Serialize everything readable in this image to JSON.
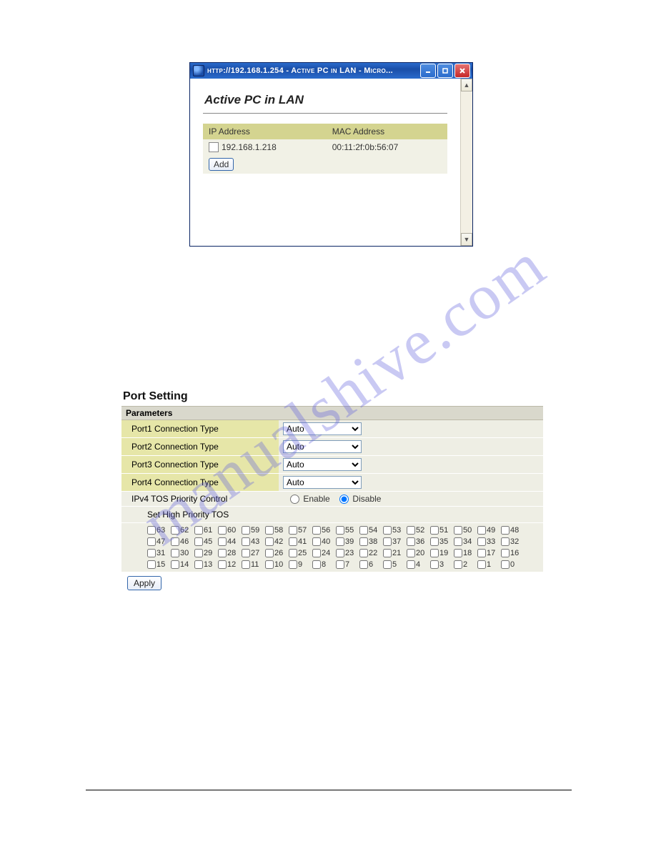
{
  "watermark": "manualshive.com",
  "ie_window": {
    "title": "http://192.168.1.254 - Active PC in LAN - Micro...",
    "heading": "Active PC in LAN",
    "columns": {
      "ip": "IP Address",
      "mac": "MAC Address"
    },
    "rows": [
      {
        "ip": "192.168.1.218",
        "mac": "00:11:2f:0b:56:07"
      }
    ],
    "add_label": "Add"
  },
  "port_setting": {
    "title": "Port Setting",
    "parameters_label": "Parameters",
    "rows": [
      {
        "label": "Port1 Connection Type",
        "value": "Auto"
      },
      {
        "label": "Port2 Connection Type",
        "value": "Auto"
      },
      {
        "label": "Port3 Connection Type",
        "value": "Auto"
      },
      {
        "label": "Port4 Connection Type",
        "value": "Auto"
      }
    ],
    "tos_control": {
      "label": "IPv4 TOS Priority Control",
      "enable": "Enable",
      "disable": "Disable",
      "selected": "disable"
    },
    "tos_heading": "Set High Priority TOS",
    "tos_values": [
      [
        63,
        62,
        61,
        60,
        59,
        58,
        57,
        56,
        55,
        54,
        53,
        52,
        51,
        50,
        49,
        48
      ],
      [
        47,
        46,
        45,
        44,
        43,
        42,
        41,
        40,
        39,
        38,
        37,
        36,
        35,
        34,
        33,
        32
      ],
      [
        31,
        30,
        29,
        28,
        27,
        26,
        25,
        24,
        23,
        22,
        21,
        20,
        19,
        18,
        17,
        16
      ],
      [
        15,
        14,
        13,
        12,
        11,
        10,
        9,
        8,
        7,
        6,
        5,
        4,
        3,
        2,
        1,
        0
      ]
    ],
    "apply_label": "Apply"
  }
}
